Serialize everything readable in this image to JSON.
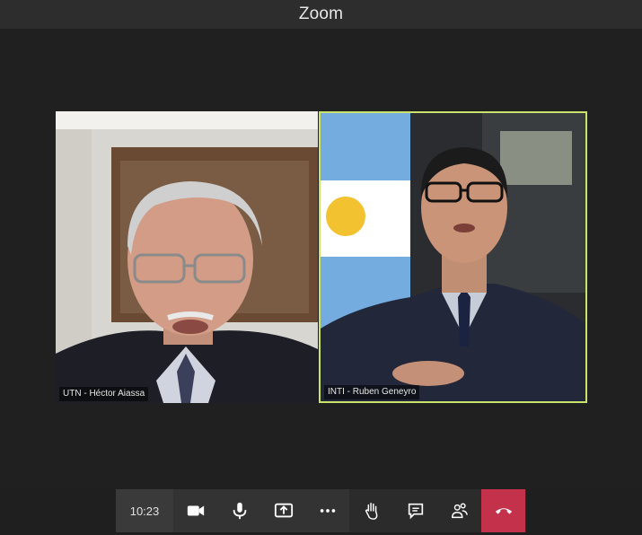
{
  "window": {
    "title": "Zoom"
  },
  "participants": [
    {
      "label": "UTN - Héctor Aiassa"
    },
    {
      "label": "INTI - Ruben Geneyro"
    }
  ],
  "toolbar": {
    "time": "10:23",
    "buttons": [
      "video-icon",
      "microphone-icon",
      "share-screen-icon",
      "more-options-icon",
      "raise-hand-icon",
      "chat-icon",
      "participants-icon"
    ],
    "hangup": "hang-up-icon"
  },
  "colors": {
    "active_speaker_border": "#c9e36a",
    "hangup": "#c4314b"
  }
}
